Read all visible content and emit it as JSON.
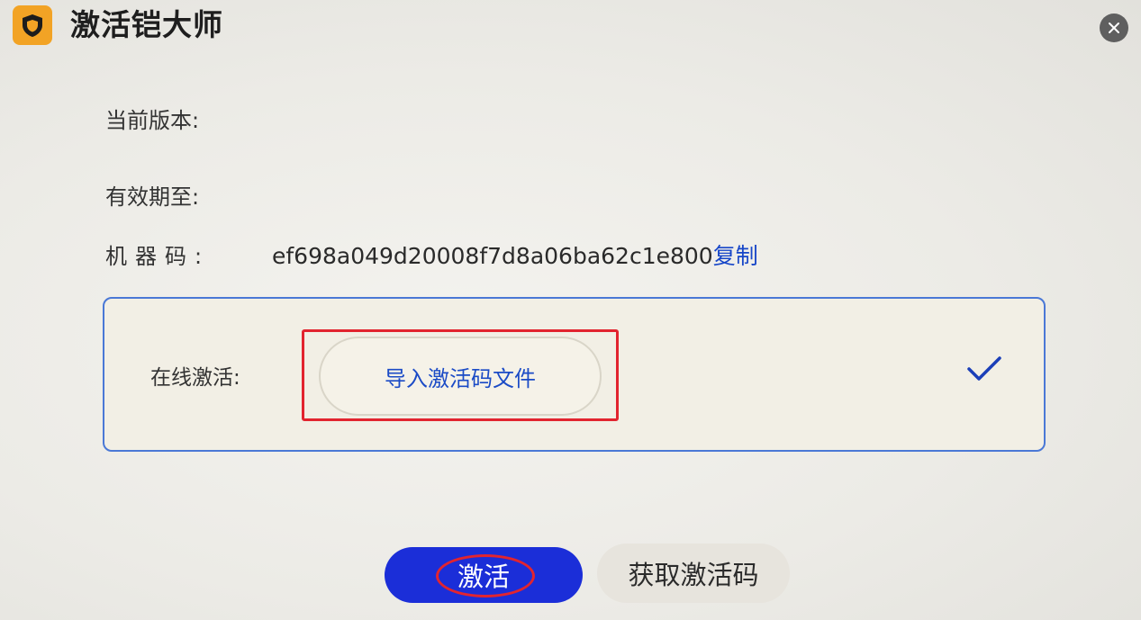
{
  "header": {
    "title": "激活铠大师",
    "logo_icon": "shield-icon",
    "close_icon": "close-icon"
  },
  "info": {
    "version_label": "当前版本:",
    "expiry_label": "有效期至:",
    "machine_label": "机器码:",
    "machine_code": "ef698a049d20008f7d8a06ba62c1e800",
    "copy_label": "复制"
  },
  "activation": {
    "online_label": "在线激活:",
    "import_button": "导入激活码文件",
    "selected_icon": "check-icon"
  },
  "footer": {
    "activate_button": "激活",
    "get_code_button": "获取激活码"
  },
  "colors": {
    "accent": "#1b2ed8",
    "link": "#1746c8",
    "logo": "#f2a325",
    "annotation": "#e2242f",
    "panel_border": "#4a78d6"
  }
}
